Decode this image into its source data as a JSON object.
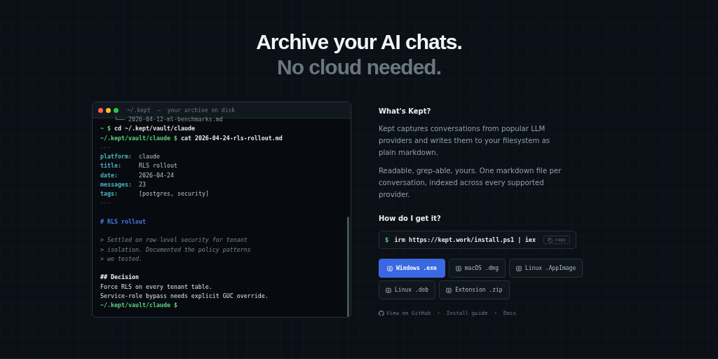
{
  "hero": {
    "title": "Archive your AI chats.",
    "subtitle": "No cloud needed."
  },
  "terminal": {
    "title": "~/.kept  —  your archive on disk",
    "lines": [
      {
        "kind": "tree",
        "text": "└── 2026-04-12-ml-benchmarks.md"
      },
      {
        "kind": "prompt",
        "prompt": "~ $",
        "command": "cd ~/.kept/vault/claude"
      },
      {
        "kind": "prompt",
        "prompt": "~/.kept/vault/claude $",
        "command": "cat 2026-04-24-rls-rollout.md"
      },
      {
        "kind": "rule",
        "text": "---"
      },
      {
        "kind": "field",
        "key": "platform:",
        "value": "claude"
      },
      {
        "kind": "field",
        "key": "title:",
        "value": "RLS rollout"
      },
      {
        "kind": "field",
        "key": "date:",
        "value": "2026-04-24"
      },
      {
        "kind": "field",
        "key": "messages:",
        "value": "23"
      },
      {
        "kind": "field",
        "key": "tags:",
        "value": "[postgres, security]"
      },
      {
        "kind": "rule",
        "text": "---"
      },
      {
        "kind": "blank"
      },
      {
        "kind": "heading",
        "text": "# RLS rollout"
      },
      {
        "kind": "blank"
      },
      {
        "kind": "quote",
        "text": "> Settled on row-level security for tenant"
      },
      {
        "kind": "quote",
        "text": "> isolation. Documented the policy patterns"
      },
      {
        "kind": "quote",
        "text": "> we tested."
      },
      {
        "kind": "blank"
      },
      {
        "kind": "subheading",
        "text": "## Decision"
      },
      {
        "kind": "text",
        "text": "Force RLS on every tenant table."
      },
      {
        "kind": "text",
        "text": "Service-role bypass needs explicit GUC override."
      },
      {
        "kind": "prompt",
        "prompt": "~/.kept/vault/claude $"
      }
    ]
  },
  "about": {
    "heading": "What's Kept?",
    "paragraphs": [
      "Kept captures conversations from popular LLM providers and writes them to your filesystem as plain markdown.",
      "Readable, grep-able, yours. One markdown file per conversation, indexed across every supported provider."
    ]
  },
  "install": {
    "heading": "How do I get it?",
    "prompt": "$",
    "command": "irm https://kept.work/install.ps1 | iex",
    "copy": "copy"
  },
  "downloads": [
    {
      "label": "Windows .exe",
      "selected": true
    },
    {
      "label": "macOS .dmg",
      "selected": false
    },
    {
      "label": "Linux .AppImage",
      "selected": false
    },
    {
      "label": "Linux .deb",
      "selected": false
    },
    {
      "label": "Extension .zip",
      "selected": false
    }
  ],
  "links": [
    {
      "kind": "github",
      "text": "View on GitHub"
    },
    {
      "kind": "dot",
      "text": "·"
    },
    {
      "kind": "link",
      "text": "Install guide"
    },
    {
      "kind": "dot",
      "text": "·"
    },
    {
      "kind": "link",
      "text": "Docs"
    }
  ]
}
